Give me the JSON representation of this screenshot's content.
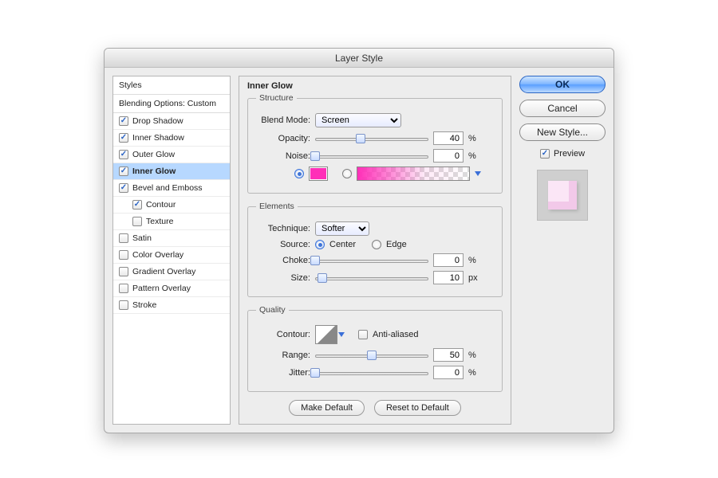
{
  "title": "Layer Style",
  "left": {
    "styles_header": "Styles",
    "blending": "Blending Options: Custom",
    "items": [
      {
        "label": "Drop Shadow",
        "checked": true
      },
      {
        "label": "Inner Shadow",
        "checked": true
      },
      {
        "label": "Outer Glow",
        "checked": true
      },
      {
        "label": "Inner Glow",
        "checked": true,
        "selected": true
      },
      {
        "label": "Bevel and Emboss",
        "checked": true
      },
      {
        "label": "Contour",
        "checked": true,
        "indent": true
      },
      {
        "label": "Texture",
        "checked": false,
        "indent": true
      },
      {
        "label": "Satin",
        "checked": false
      },
      {
        "label": "Color Overlay",
        "checked": false
      },
      {
        "label": "Gradient Overlay",
        "checked": false
      },
      {
        "label": "Pattern Overlay",
        "checked": false
      },
      {
        "label": "Stroke",
        "checked": false
      }
    ]
  },
  "panel": {
    "title": "Inner Glow",
    "structure": {
      "legend": "Structure",
      "blend_label": "Blend Mode:",
      "blend_value": "Screen",
      "opacity_label": "Opacity:",
      "opacity_value": "40",
      "opacity_pct": 40,
      "noise_label": "Noise:",
      "noise_value": "0",
      "noise_pct": 0,
      "pct": "%",
      "color": "#ff2fb8"
    },
    "elements": {
      "legend": "Elements",
      "technique_label": "Technique:",
      "technique_value": "Softer",
      "source_label": "Source:",
      "source_center": "Center",
      "source_edge": "Edge",
      "source_value": "center",
      "choke_label": "Choke:",
      "choke_value": "0",
      "choke_pct": 0,
      "size_label": "Size:",
      "size_value": "10",
      "size_pct": 6,
      "pct": "%",
      "px": "px"
    },
    "quality": {
      "legend": "Quality",
      "contour_label": "Contour:",
      "aa_label": "Anti-aliased",
      "aa_checked": false,
      "range_label": "Range:",
      "range_value": "50",
      "range_pct": 50,
      "jitter_label": "Jitter:",
      "jitter_value": "0",
      "jitter_pct": 0,
      "pct": "%"
    },
    "make_default": "Make Default",
    "reset_default": "Reset to Default"
  },
  "right": {
    "ok": "OK",
    "cancel": "Cancel",
    "new_style": "New Style...",
    "preview_label": "Preview",
    "preview_checked": true
  }
}
